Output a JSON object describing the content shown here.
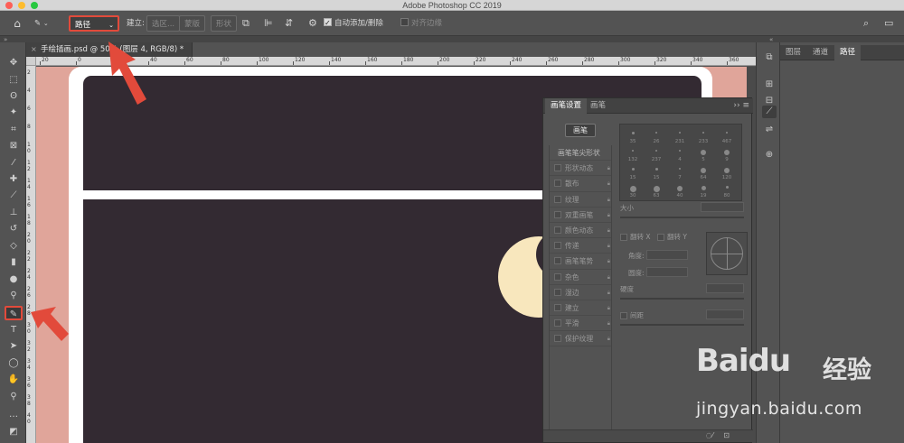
{
  "window": {
    "title": "Adobe Photoshop CC 2019"
  },
  "options_bar": {
    "mode_value": "路径",
    "make_label": "建立:",
    "selection_label": "选区...",
    "mask_label": "蒙版",
    "shape_label": "形状",
    "auto_add_delete_label": "自动添加/删除",
    "align_edges_label": "对齐边缘",
    "auto_add_delete_checked": true
  },
  "document": {
    "tab_title": "手绘插画.psd @ 50% (图层 4, RGB/8) *",
    "close_glyph": "×"
  },
  "rulers": {
    "top_labels": [
      "20",
      "0",
      "20",
      "40",
      "60",
      "80",
      "100",
      "120",
      "140",
      "160",
      "180",
      "200",
      "220",
      "240",
      "260",
      "280",
      "300",
      "320",
      "340",
      "360"
    ],
    "left_labels": [
      "2",
      "4",
      "6",
      "8",
      "1 0",
      "1 2",
      "1 4",
      "1 6",
      "1 8",
      "2 0",
      "2 2",
      "2 4",
      "2 6",
      "2 8",
      "3 0",
      "3 2",
      "3 4",
      "3 6",
      "3 8",
      "4 0"
    ]
  },
  "brush_panel": {
    "tab_settings": "画笔设置",
    "tab_brush": "画笔",
    "brushes_button": "画笔",
    "tip_shape_header": "画笔笔尖形状",
    "items": [
      {
        "label": "形状动态"
      },
      {
        "label": "散布"
      },
      {
        "label": "纹理"
      },
      {
        "label": "双重画笔"
      },
      {
        "label": "颜色动态"
      },
      {
        "label": "传递"
      },
      {
        "label": "画笔笔势"
      },
      {
        "label": "杂色"
      },
      {
        "label": "湿边"
      },
      {
        "label": "建立"
      },
      {
        "label": "平滑"
      },
      {
        "label": "保护纹理"
      }
    ],
    "tip_sizes": [
      "35",
      "26",
      "231",
      "233",
      "467",
      "132",
      "237",
      "4",
      "5",
      "9",
      "15",
      "15",
      "7",
      "64",
      "120",
      "30",
      "63",
      "40",
      "19",
      "80"
    ],
    "size_label": "大小",
    "flip_x_label": "翻转 X",
    "flip_y_label": "翻转 Y",
    "angle_label": "角度:",
    "roundness_label": "圆度:",
    "hardness_label": "硬度",
    "spacing_label": "间距"
  },
  "layers_panel": {
    "tab_layers": "图层",
    "tab_channels": "通道",
    "tab_paths": "路径"
  },
  "watermark": {
    "logo_text": "Bai",
    "logo_du": "du",
    "logo_cn": "经验",
    "url": "jingyan.baidu.com"
  },
  "colors": {
    "accent_annotation": "#e24a3b",
    "canvas_pink": "#e0a59a",
    "panel_dark": "#332a32",
    "moon": "#f8e7bd"
  }
}
